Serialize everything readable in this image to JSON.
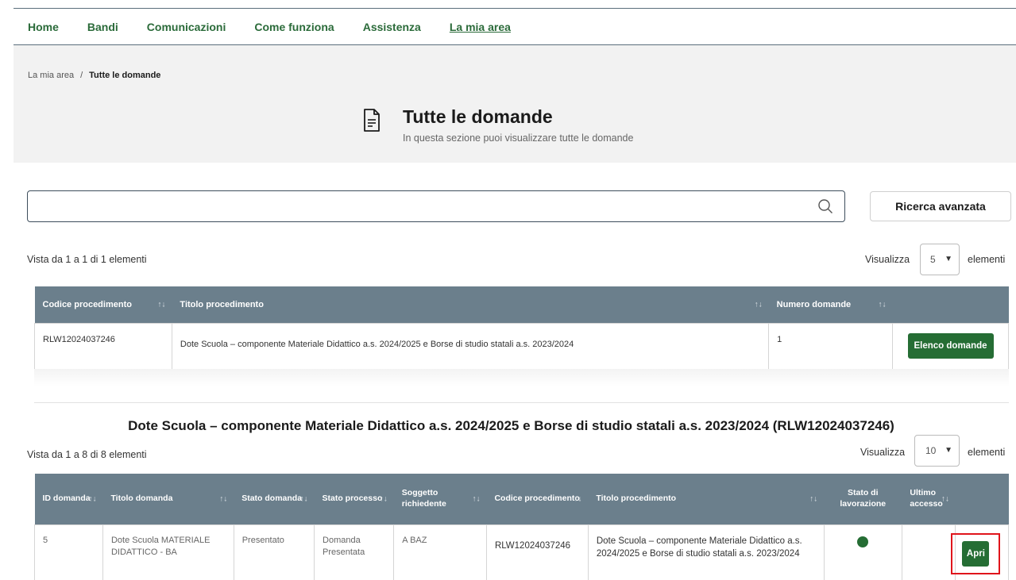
{
  "nav": {
    "items": [
      {
        "label": "Home",
        "active": false
      },
      {
        "label": "Bandi",
        "active": false
      },
      {
        "label": "Comunicazioni",
        "active": false
      },
      {
        "label": "Come funziona",
        "active": false
      },
      {
        "label": "Assistenza",
        "active": false
      },
      {
        "label": "La mia area",
        "active": true
      }
    ]
  },
  "breadcrumb": {
    "root": "La mia area",
    "separator": "/",
    "current": "Tutte le domande"
  },
  "header": {
    "icon": "document-icon",
    "title": "Tutte le domande",
    "subtitle": "In questa sezione puoi visualizzare tutte le domande"
  },
  "search": {
    "value": "",
    "placeholder": "",
    "icon": "search-icon",
    "advanced_label": "Ricerca avanzata"
  },
  "procedures": {
    "info": "Vista da 1 a 1 di 1 elementi",
    "show_label": "Visualizza",
    "page_size": "5",
    "elements_label": "elementi",
    "columns": [
      "Codice procedimento",
      "Titolo procedimento",
      "Numero domande",
      ""
    ],
    "rows": [
      {
        "codice": "RLW12024037246",
        "titolo": "Dote Scuola – componente Materiale Didattico a.s. 2024/2025 e Borse di studio statali a.s. 2023/2024",
        "numero": "1",
        "action": "Elenco domande"
      }
    ]
  },
  "applications": {
    "section_title": "Dote Scuola – componente Materiale Didattico a.s. 2024/2025 e Borse di studio statali a.s. 2023/2024 (RLW12024037246)",
    "info": "Vista da 1 a 8 di 8 elementi",
    "show_label": "Visualizza",
    "page_size": "10",
    "elements_label": "elementi",
    "columns": [
      "ID domanda",
      "Titolo domanda",
      "Stato domanda",
      "Stato processo",
      "Soggetto richiedente",
      "Codice procedimento",
      "Titolo procedimento",
      "Stato di lavorazione",
      "Ultimo accesso",
      ""
    ],
    "rows": [
      {
        "id": "5",
        "titolo_domanda": "Dote Scuola MATERIALE DIDATTICO - BA",
        "stato_domanda": "Presentato",
        "stato_processo": "Domanda Presentata",
        "soggetto": "A BAZ",
        "codice": "RLW12024037246",
        "titolo_procedimento": "Dote Scuola – componente Materiale Didattico a.s. 2024/2025 e Borse di studio statali a.s. 2023/2024",
        "stato_lavorazione_color": "#256d34",
        "ultimo_accesso": "",
        "action": "Apri"
      }
    ]
  },
  "colors": {
    "accent_green": "#256d34",
    "nav_green": "#2b6b3a",
    "table_header": "#6b7f8c",
    "highlight_red": "#e0141b"
  }
}
